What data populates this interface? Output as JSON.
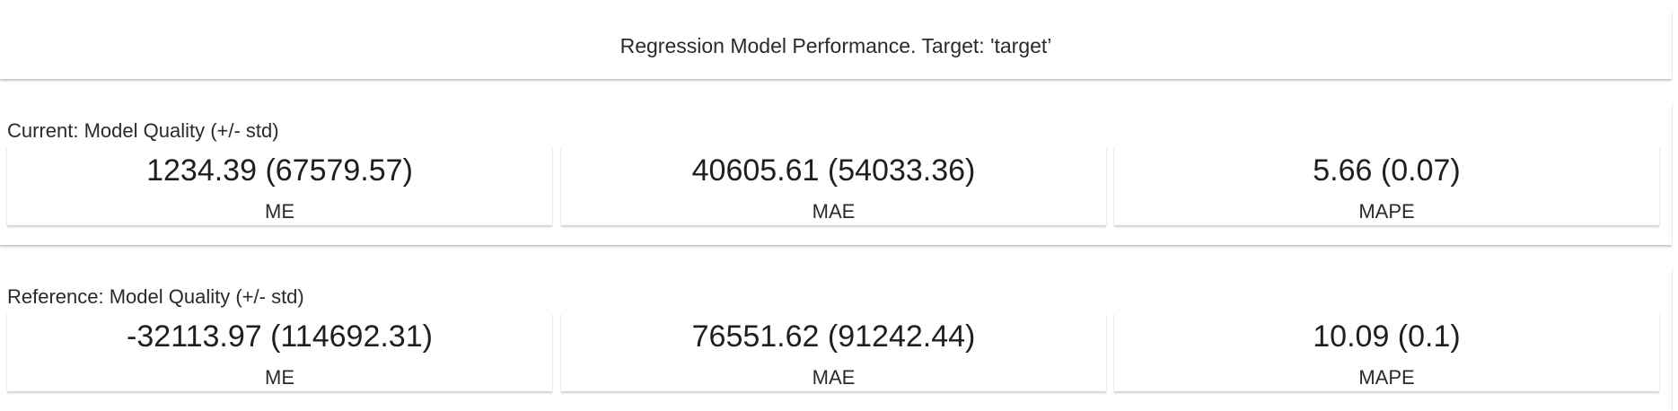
{
  "header": {
    "title": "Regression Model Performance. Target: 'target’"
  },
  "current": {
    "title": "Current: Model Quality (+/- std)",
    "metrics": [
      {
        "value": "1234.39 (67579.57)",
        "label": "ME"
      },
      {
        "value": "40605.61 (54033.36)",
        "label": "MAE"
      },
      {
        "value": "5.66 (0.07)",
        "label": "MAPE"
      }
    ]
  },
  "reference": {
    "title": "Reference: Model Quality (+/- std)",
    "metrics": [
      {
        "value": "-32113.97 (114692.31)",
        "label": "ME"
      },
      {
        "value": "76551.62 (91242.44)",
        "label": "MAE"
      },
      {
        "value": "10.09 (0.1)",
        "label": "MAPE"
      }
    ]
  }
}
